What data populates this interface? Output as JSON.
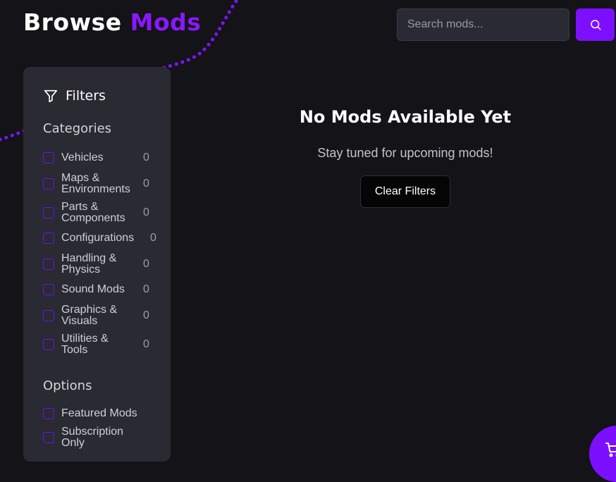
{
  "header": {
    "title_part1": "Browse",
    "title_part2": "Mods",
    "search_placeholder": "Search mods...",
    "search_icon": "search-icon"
  },
  "sidebar": {
    "filters_label": "Filters",
    "filter_icon": "filter-icon",
    "categories_heading": "Categories",
    "categories": [
      {
        "label": "Vehicles",
        "count": "0"
      },
      {
        "label": "Maps & Environments",
        "count": "0"
      },
      {
        "label": "Parts & Components",
        "count": "0"
      },
      {
        "label": "Configurations",
        "count": "0"
      },
      {
        "label": "Handling & Physics",
        "count": "0"
      },
      {
        "label": "Sound Mods",
        "count": "0"
      },
      {
        "label": "Graphics & Visuals",
        "count": "0"
      },
      {
        "label": "Utilities & Tools",
        "count": "0"
      }
    ],
    "options_heading": "Options",
    "options": [
      {
        "label": "Featured Mods"
      },
      {
        "label": "Subscription Only"
      }
    ]
  },
  "main": {
    "empty_title": "No Mods Available Yet",
    "empty_subtitle": "Stay tuned for upcoming mods!",
    "clear_filters_label": "Clear Filters"
  },
  "cart_icon": "cart-icon",
  "colors": {
    "accent": "#8a17ff",
    "background": "#141317",
    "panel": "#2a2a33"
  }
}
